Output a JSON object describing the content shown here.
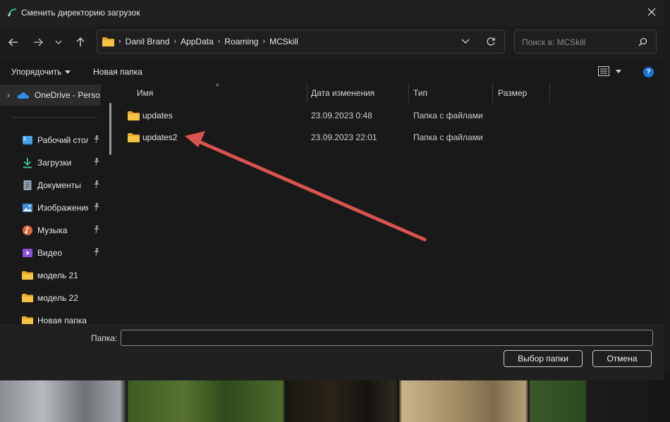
{
  "window": {
    "title": "Сменить директорию загрузок",
    "close_glyph": "×"
  },
  "address": {
    "crumbs": [
      "Danil Brand",
      "AppData",
      "Roaming",
      "MCSkill"
    ],
    "separator": "›"
  },
  "search": {
    "placeholder": "Поиск в: MCSkill"
  },
  "toolbar": {
    "organize_label": "Упорядочить",
    "new_folder_label": "Новая папка",
    "help_glyph": "?"
  },
  "nav": {
    "onedrive_label": "OneDrive - Perso",
    "items": [
      {
        "label": "Рабочий стол",
        "icon": "desktop-icon",
        "pinned": true
      },
      {
        "label": "Загрузки",
        "icon": "downloads-icon",
        "pinned": true
      },
      {
        "label": "Документы",
        "icon": "documents-icon",
        "pinned": true
      },
      {
        "label": "Изображения",
        "icon": "pictures-icon",
        "pinned": true
      },
      {
        "label": "Музыка",
        "icon": "music-icon",
        "pinned": true
      },
      {
        "label": "Видео",
        "icon": "videos-icon",
        "pinned": true
      },
      {
        "label": "модель 21",
        "icon": "folder-icon",
        "pinned": false
      },
      {
        "label": "модель 22",
        "icon": "folder-icon",
        "pinned": false
      },
      {
        "label": "Новая папка",
        "icon": "folder-icon",
        "pinned": false
      }
    ]
  },
  "list": {
    "headers": {
      "name": "Имя",
      "date": "Дата изменения",
      "type": "Тип",
      "size": "Размер"
    },
    "rows": [
      {
        "name": "updates",
        "date": "23.09.2023 0:48",
        "type": "Папка с файлами"
      },
      {
        "name": "updates2",
        "date": "23.09.2023 22:01",
        "type": "Папка с файлами"
      }
    ]
  },
  "footer": {
    "folder_label": "Папка:",
    "folder_value": "",
    "ok_label": "Выбор папки",
    "cancel_label": "Отмена"
  },
  "colors": {
    "dialog_bg": "#191919",
    "titlebar_bg": "#202020",
    "text": "#e6e6e6",
    "folder_yellow": "#f6c343",
    "help_blue": "#1b74d8",
    "annotation_arrow": "#d9534f"
  }
}
